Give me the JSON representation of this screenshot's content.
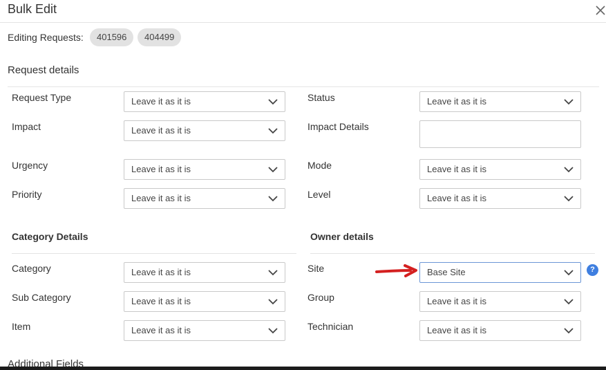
{
  "dialog": {
    "title": "Bulk Edit"
  },
  "editing": {
    "label": "Editing Requests:",
    "requests": [
      "401596",
      "404499"
    ]
  },
  "sections": {
    "request_details": "Request details",
    "category_details": "Category Details",
    "owner_details": "Owner details",
    "additional_fields": "Additional Fields"
  },
  "fields": {
    "request_type": {
      "label": "Request Type",
      "value": "Leave it as it is"
    },
    "status": {
      "label": "Status",
      "value": "Leave it as it is"
    },
    "impact": {
      "label": "Impact",
      "value": "Leave it as it is"
    },
    "impact_details": {
      "label": "Impact Details",
      "value": ""
    },
    "urgency": {
      "label": "Urgency",
      "value": "Leave it as it is"
    },
    "mode": {
      "label": "Mode",
      "value": "Leave it as it is"
    },
    "priority": {
      "label": "Priority",
      "value": "Leave it as it is"
    },
    "level": {
      "label": "Level",
      "value": "Leave it as it is"
    },
    "category": {
      "label": "Category",
      "value": "Leave it as it is"
    },
    "site": {
      "label": "Site",
      "value": "Base Site",
      "help": "?"
    },
    "sub_category": {
      "label": "Sub Category",
      "value": "Leave it as it is"
    },
    "group": {
      "label": "Group",
      "value": "Leave it as it is"
    },
    "item": {
      "label": "Item",
      "value": "Leave it as it is"
    },
    "technician": {
      "label": "Technician",
      "value": "Leave it as it is"
    }
  },
  "icons": {
    "close": "close-icon",
    "chevron": "chevron-down-icon",
    "help": "help-icon",
    "annotation": "red-arrow-icon"
  },
  "colors": {
    "accent": "#3f7fe0",
    "annotation_arrow": "#d42020",
    "chip_bg": "#e2e2e2",
    "border": "#c9c9c9"
  }
}
